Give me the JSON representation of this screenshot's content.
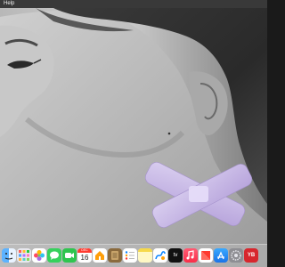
{
  "menubar": {
    "items": [
      "Help"
    ]
  },
  "wallpaper": {
    "description_icon": "portrait-wallpaper"
  },
  "dock": {
    "apps": [
      {
        "name": "finder",
        "icon": "finder-icon"
      },
      {
        "name": "launchpad",
        "icon": "launchpad-icon"
      },
      {
        "name": "photos",
        "icon": "photos-icon"
      },
      {
        "name": "messages",
        "icon": "messages-icon"
      },
      {
        "name": "facetime",
        "icon": "facetime-icon"
      },
      {
        "name": "calendar",
        "icon": "calendar-icon",
        "month": "DEC",
        "day": "16"
      },
      {
        "name": "home",
        "icon": "home-icon"
      },
      {
        "name": "notes-brown",
        "icon": "notes-icon"
      },
      {
        "name": "reminders",
        "icon": "reminders-icon"
      },
      {
        "name": "stickies",
        "icon": "stickies-icon"
      },
      {
        "name": "freeform",
        "icon": "freeform-icon"
      },
      {
        "name": "apple-tv",
        "icon": "apple-tv-icon",
        "label": "tv"
      },
      {
        "name": "music",
        "icon": "music-icon"
      },
      {
        "name": "news",
        "icon": "news-icon"
      },
      {
        "name": "app-store",
        "icon": "app-store-icon"
      },
      {
        "name": "system-settings",
        "icon": "settings-icon"
      },
      {
        "name": "youtube-app",
        "icon": "video-app-icon",
        "label": "YB"
      }
    ]
  },
  "colors": {
    "menubar_bg": "#3c3c3c",
    "bandage": "#c7b5e6",
    "dock_bg": "#c8c8c8"
  }
}
